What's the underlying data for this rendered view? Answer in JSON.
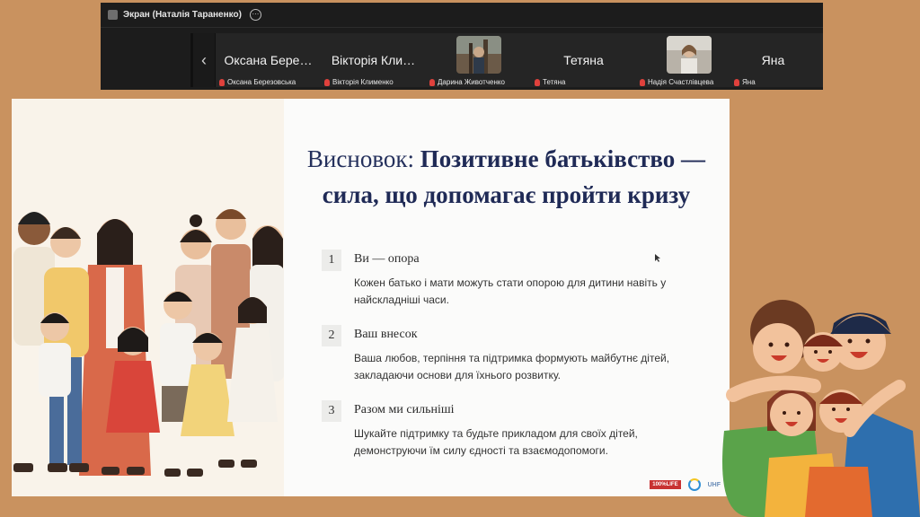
{
  "zoom": {
    "title": "Экран (Наталія Тараненко)",
    "more_glyph": "···",
    "prev_glyph": "‹",
    "participants": [
      {
        "name": "Оксана Бере…",
        "label": "Оксана Березовська",
        "video": false
      },
      {
        "name": "Вікторія Кли…",
        "label": "Вікторія Клименко",
        "video": false
      },
      {
        "name": "",
        "label": "Дарина Животченко",
        "video": true
      },
      {
        "name": "Тетяна",
        "label": "Тетяна",
        "video": false
      },
      {
        "name": "",
        "label": "Надія Счастлівцева",
        "video": true
      },
      {
        "name": "Яна",
        "label": "Яна",
        "video": false
      }
    ]
  },
  "slide": {
    "heading_plain": "Висновок: ",
    "heading_bold_1": "Позитивне батьківство —",
    "heading_bold_2": "сила, що допомагає пройти кризу",
    "items": [
      {
        "num": "1",
        "title": "Ви — опора",
        "desc": "Кожен батько і мати можуть стати опорою для дитини навіть у найскладніші часи."
      },
      {
        "num": "2",
        "title": "Ваш внесок",
        "desc": "Ваша любов, терпіння та підтримка формують майбутнє дітей, закладаючи основи для їхнього розвитку."
      },
      {
        "num": "3",
        "title": "Разом ми сильніші",
        "desc": "Шукайте підтримку та будьте прикладом для своїх дітей, демонструючи їм силу єдності та взаємодопомоги."
      }
    ],
    "logos": {
      "red": "100%LIFE",
      "uhf": "UHF"
    }
  },
  "colors": {
    "background": "#c9925f",
    "zoom_bar": "#1c1c1c",
    "heading": "#24305c",
    "mute": "#e0413c"
  }
}
